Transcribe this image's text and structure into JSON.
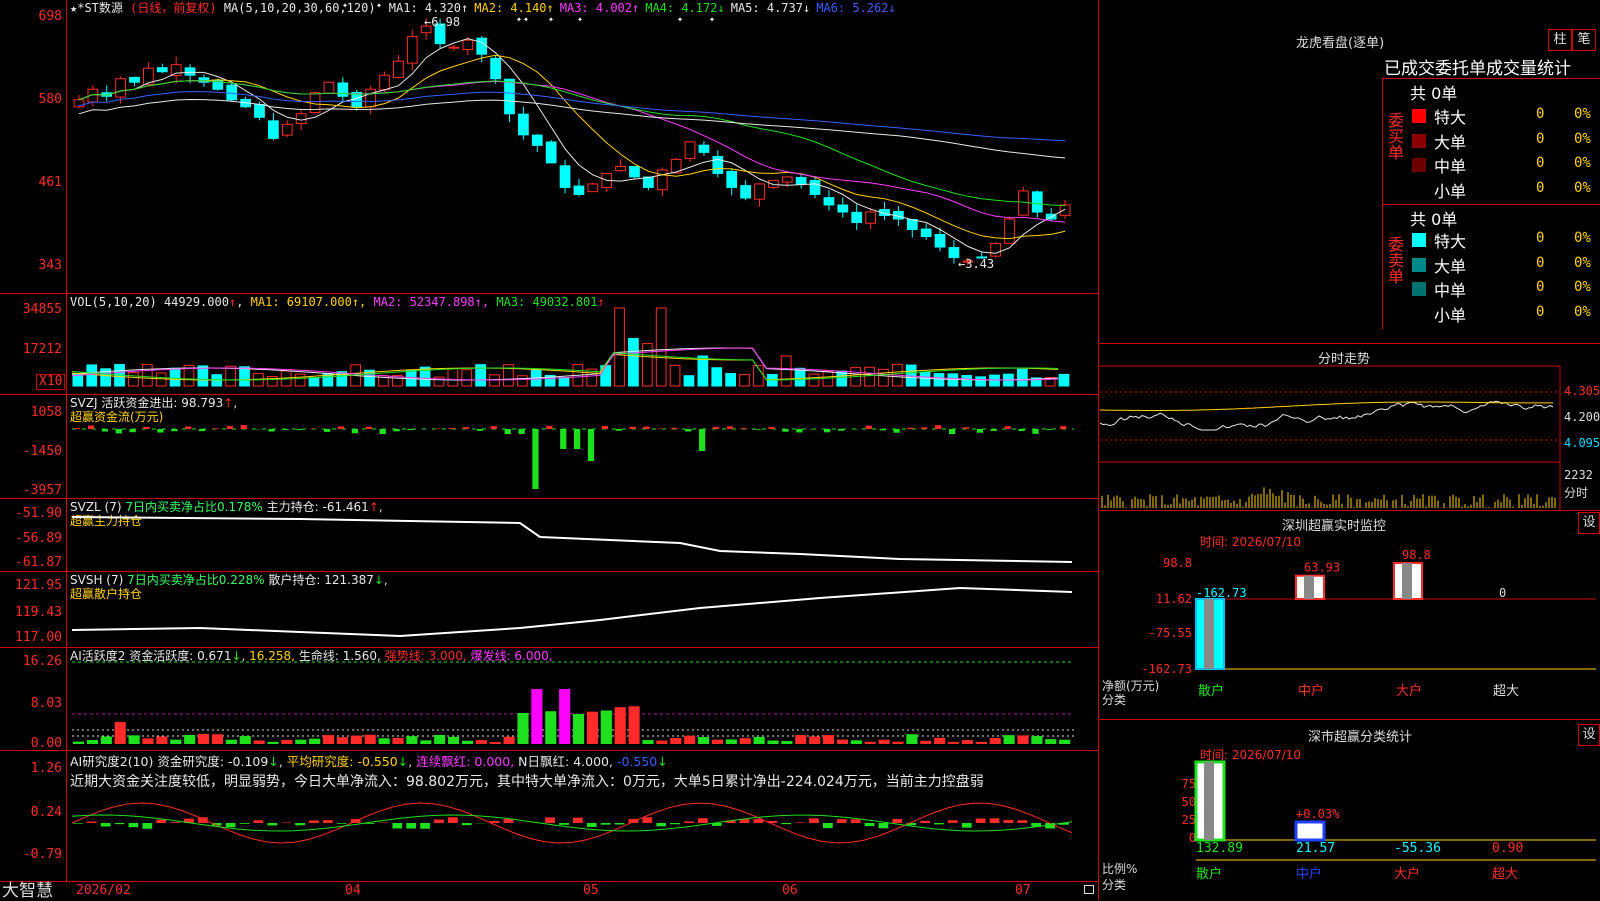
{
  "app": {
    "logo": "大智慧"
  },
  "kline": {
    "title": "★*ST数源",
    "period": "(日线，前复权)",
    "ma_params": "MA(5,10,20,30,60,120)",
    "ma": [
      {
        "label": "MA1:",
        "value": "4.320",
        "arrow": "↑",
        "color": "#e8e8e8"
      },
      {
        "label": "MA2:",
        "value": "4.140",
        "arrow": "↑",
        "color": "#ffd400"
      },
      {
        "label": "MA3:",
        "value": "4.002",
        "arrow": "↑",
        "color": "#ff3cff"
      },
      {
        "label": "MA4:",
        "value": "4.172",
        "arrow": "↓",
        "color": "#1ee01e"
      },
      {
        "label": "MA5:",
        "value": "4.737",
        "arrow": "↓",
        "color": "#e8e8e8"
      },
      {
        "label": "MA6:",
        "value": "5.262",
        "arrow": "↓",
        "color": "#3c5cff"
      }
    ],
    "y_labels": [
      "698",
      "580",
      "461",
      "343"
    ],
    "high_label": "6.98",
    "low_label": "3.43",
    "colors": {
      "up": "#ff2a2a",
      "down": "#00ffff"
    }
  },
  "vol": {
    "header": "VOL(5,10,20)",
    "value": "44929.000",
    "ma1": "69107.000",
    "ma2": "52347.898",
    "ma3": "49032.801",
    "y_labels": [
      "34855",
      "17212"
    ],
    "scale": "X10"
  },
  "svzj": {
    "header": "SVZJ",
    "label": "活跃资金进出:",
    "value": "98.793",
    "subtitle": "超赢资金流(万元)",
    "y_labels": [
      "1058",
      "-1450",
      "-3957"
    ]
  },
  "svzl": {
    "header": "SVZL (7)",
    "ratio": "7日内买卖净占比0.178%",
    "label": "主力持仓:",
    "value": "-61.461",
    "subtitle": "超赢主力持仓",
    "y_labels": [
      "-51.90",
      "-56.89",
      "-61.87"
    ]
  },
  "svsh": {
    "header": "SVSH (7)",
    "ratio": "7日内买卖净占比0.228%",
    "label": "散户持仓:",
    "value": "121.387",
    "subtitle": "超赢散户持仓",
    "y_labels": [
      "121.95",
      "119.43",
      "117.00"
    ]
  },
  "ai1": {
    "header": "AI活跃度2",
    "label": "资金活跃度:",
    "value": "0.671",
    "v2": "16.258",
    "life_label": "生命线:",
    "life_value": "1.560",
    "strong": "强势线: 3.000",
    "burst": "爆发线: 6.000",
    "y_labels": [
      "16.26",
      "8.03",
      "0.00"
    ]
  },
  "ai2": {
    "header": "AI研究度2(10)",
    "label": "资金研究度:",
    "value": "-0.109",
    "avg": "平均研究度: -0.550",
    "streak": "连续飘红: 0.000",
    "nday": "N日飘红: 4.000",
    "last": "-0.550",
    "commentary": "近期大资金关注度较低，明显弱势，今日大单净流入：98.802万元，其中特大单净流入：0万元，大单5日累计净出-224.024万元，当前主力控盘弱",
    "y_labels": [
      "1.26",
      "0.24",
      "-0.79"
    ]
  },
  "xaxis": {
    "labels": [
      "2026/02",
      "04",
      "05",
      "06",
      "07"
    ]
  },
  "dragon": {
    "title": "龙虎看盘(逐单)",
    "btn_bar": "柱",
    "btn_pen": "笔",
    "section_title": "已成交委托单成交量统计",
    "buy_side": "委买单",
    "sell_side": "委卖单",
    "buy_total": "共 0单",
    "sell_total": "共 0单",
    "buy_rows": [
      {
        "label": "特大",
        "count": "0",
        "pct": "0%",
        "color": "#ff0000"
      },
      {
        "label": "大单",
        "count": "0",
        "pct": "0%",
        "color": "#8b0000"
      },
      {
        "label": "中单",
        "count": "0",
        "pct": "0%",
        "color": "#6b0000"
      },
      {
        "label": "小单",
        "count": "0",
        "pct": "0%",
        "color": "#000000"
      }
    ],
    "sell_rows": [
      {
        "label": "特大",
        "count": "0",
        "pct": "0%",
        "color": "#00ffff"
      },
      {
        "label": "大单",
        "count": "0",
        "pct": "0%",
        "color": "#008b8b"
      },
      {
        "label": "中单",
        "count": "0",
        "pct": "0%",
        "color": "#007070"
      },
      {
        "label": "小单",
        "count": "0",
        "pct": "0%",
        "color": "#000000"
      }
    ]
  },
  "intraday": {
    "title": "分时走势",
    "y_labels": [
      "4.305",
      "4.200",
      "4.095"
    ],
    "vol_label": "2232",
    "vol_unit": "分时"
  },
  "sz_monitor": {
    "title": "深圳超赢实时监控",
    "btn": "设",
    "time": "时间: 2026/07/10",
    "y_labels": [
      "98.8",
      "11.62",
      "-75.55",
      "-162.73"
    ],
    "y_unit": "净额(万元)",
    "x_title": "分类",
    "categories": [
      "散户",
      "中户",
      "大户",
      "超大"
    ],
    "values": [
      -162.73,
      63.93,
      98.8,
      0
    ],
    "value_labels": [
      "-162.73",
      "63.93",
      "98.8",
      "0"
    ]
  },
  "sz_stats": {
    "title": "深市超赢分类统计",
    "btn": "设",
    "time": "时间: 2026/07/10",
    "y_labels": [
      "75",
      "50",
      "25",
      "0"
    ],
    "y_unit": "比例%",
    "x_title": "分类",
    "categories": [
      "散户",
      "中户",
      "大户",
      "超大"
    ],
    "pct_label": "+0.03%",
    "values": [
      "132.89",
      "21.57",
      "-55.36",
      "0.90"
    ]
  }
}
